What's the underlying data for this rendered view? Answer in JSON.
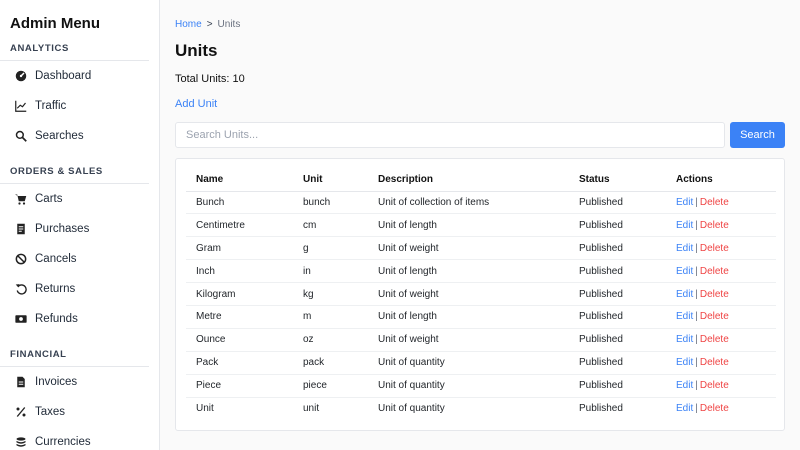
{
  "sidebar": {
    "title": "Admin Menu",
    "sections": [
      {
        "title": "ANALYTICS",
        "items": [
          {
            "label": "Dashboard",
            "icon": "dashboard-icon"
          },
          {
            "label": "Traffic",
            "icon": "chart-line-icon"
          },
          {
            "label": "Searches",
            "icon": "search-icon"
          }
        ]
      },
      {
        "title": "ORDERS & SALES",
        "items": [
          {
            "label": "Carts",
            "icon": "cart-icon"
          },
          {
            "label": "Purchases",
            "icon": "receipt-icon"
          },
          {
            "label": "Cancels",
            "icon": "ban-icon"
          },
          {
            "label": "Returns",
            "icon": "undo-icon"
          },
          {
            "label": "Refunds",
            "icon": "money-icon"
          }
        ]
      },
      {
        "title": "FINANCIAL",
        "items": [
          {
            "label": "Invoices",
            "icon": "invoice-icon"
          },
          {
            "label": "Taxes",
            "icon": "percent-icon"
          },
          {
            "label": "Currencies",
            "icon": "coins-icon"
          }
        ]
      }
    ]
  },
  "breadcrumb": {
    "home": "Home",
    "separator": ">",
    "current": "Units"
  },
  "page": {
    "title": "Units",
    "total": "Total Units: 10",
    "add_label": "Add Unit",
    "search_placeholder": "Search Units...",
    "search_button": "Search"
  },
  "table": {
    "headers": [
      "Name",
      "Unit",
      "Description",
      "Status",
      "Actions"
    ],
    "edit_label": "Edit",
    "action_separator": "|",
    "delete_label": "Delete",
    "rows": [
      {
        "name": "Bunch",
        "unit": "bunch",
        "description": "Unit of collection of items",
        "status": "Published"
      },
      {
        "name": "Centimetre",
        "unit": "cm",
        "description": "Unit of length",
        "status": "Published"
      },
      {
        "name": "Gram",
        "unit": "g",
        "description": "Unit of weight",
        "status": "Published"
      },
      {
        "name": "Inch",
        "unit": "in",
        "description": "Unit of length",
        "status": "Published"
      },
      {
        "name": "Kilogram",
        "unit": "kg",
        "description": "Unit of weight",
        "status": "Published"
      },
      {
        "name": "Metre",
        "unit": "m",
        "description": "Unit of length",
        "status": "Published"
      },
      {
        "name": "Ounce",
        "unit": "oz",
        "description": "Unit of weight",
        "status": "Published"
      },
      {
        "name": "Pack",
        "unit": "pack",
        "description": "Unit of quantity",
        "status": "Published"
      },
      {
        "name": "Piece",
        "unit": "piece",
        "description": "Unit of quantity",
        "status": "Published"
      },
      {
        "name": "Unit",
        "unit": "unit",
        "description": "Unit of quantity",
        "status": "Published"
      }
    ]
  },
  "colors": {
    "accent": "#3b82f6",
    "danger": "#ef4444"
  }
}
